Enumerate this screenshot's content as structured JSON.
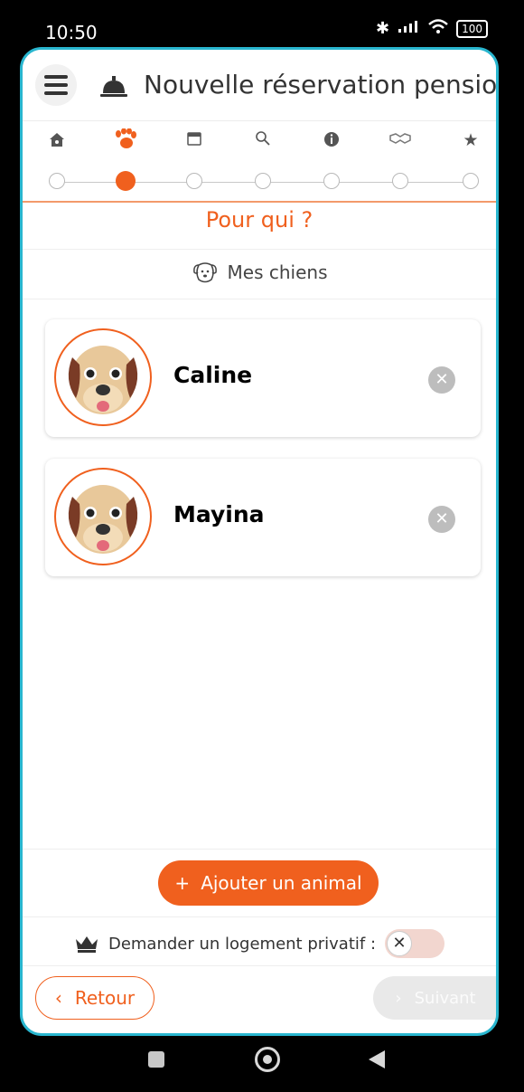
{
  "status_bar": {
    "time": "10:50",
    "battery": "100"
  },
  "header": {
    "title": "Nouvelle réservation pension"
  },
  "steps": [
    {
      "icon": "home-icon",
      "active": false
    },
    {
      "icon": "paw-icon",
      "active": true
    },
    {
      "icon": "calendar-icon",
      "active": false
    },
    {
      "icon": "search-icon",
      "active": false
    },
    {
      "icon": "info-icon",
      "active": false
    },
    {
      "icon": "handshake-icon",
      "active": false
    },
    {
      "icon": "star-icon",
      "active": false
    }
  ],
  "section": {
    "title": "Pour qui ?",
    "subheading": "Mes chiens"
  },
  "pets": [
    {
      "name": "Caline"
    },
    {
      "name": "Mayina"
    }
  ],
  "actions": {
    "add_label": "Ajouter un animal",
    "private_label": "Demander un logement privatif :",
    "back_label": "Retour",
    "next_label": "Suivant"
  },
  "colors": {
    "accent": "#f0601e",
    "frame": "#29b6cf"
  }
}
